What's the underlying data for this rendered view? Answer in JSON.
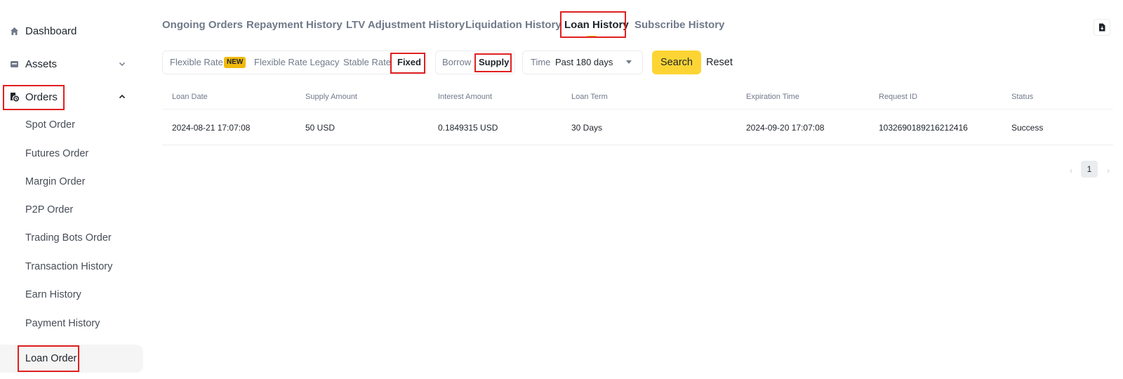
{
  "sidebar": {
    "items": [
      {
        "label": "Dashboard",
        "icon": "home-icon"
      },
      {
        "label": "Assets",
        "icon": "wallet-icon",
        "expandable": true
      },
      {
        "label": "Orders",
        "icon": "orders-icon",
        "expandable": true,
        "expanded": true
      }
    ],
    "sub_items": [
      {
        "label": "Spot Order"
      },
      {
        "label": "Futures Order"
      },
      {
        "label": "Margin Order"
      },
      {
        "label": "P2P Order"
      },
      {
        "label": "Trading Bots Order"
      },
      {
        "label": "Transaction History"
      },
      {
        "label": "Earn History"
      },
      {
        "label": "Payment History"
      },
      {
        "label": "Loan Order",
        "active": true
      }
    ]
  },
  "tabs": [
    {
      "label": "Ongoing Orders"
    },
    {
      "label": "Repayment History"
    },
    {
      "label": "LTV Adjustment History"
    },
    {
      "label": "Liquidation History"
    },
    {
      "label": "Loan History",
      "active": true
    },
    {
      "label": "Subscribe History"
    }
  ],
  "filters": {
    "rate_types": [
      {
        "label": "Flexible Rate",
        "badge": "NEW"
      },
      {
        "label": "Flexible Rate Legacy"
      },
      {
        "label": "Stable Rate"
      },
      {
        "label": "Fixed",
        "active": true
      }
    ],
    "sides": [
      {
        "label": "Borrow"
      },
      {
        "label": "Supply",
        "active": true
      }
    ],
    "time_label": "Time",
    "time_value": "Past 180 days",
    "search_label": "Search",
    "reset_label": "Reset"
  },
  "table": {
    "headers": [
      "Loan Date",
      "Supply Amount",
      "Interest Amount",
      "Loan Term",
      "Expiration Time",
      "Request ID",
      "Status"
    ],
    "rows": [
      [
        "2024-08-21 17:07:08",
        "50 USD",
        "0.1849315 USD",
        "30 Days",
        "2024-09-20 17:07:08",
        "1032690189216212416",
        "Success"
      ]
    ]
  },
  "pagination": {
    "current_page": "1",
    "prev_icon": "chevron-left-icon",
    "next_icon": "chevron-right-icon"
  },
  "colors": {
    "accent": "#f0b90b",
    "primary_button": "#fcd535",
    "highlight": "#e02020"
  }
}
